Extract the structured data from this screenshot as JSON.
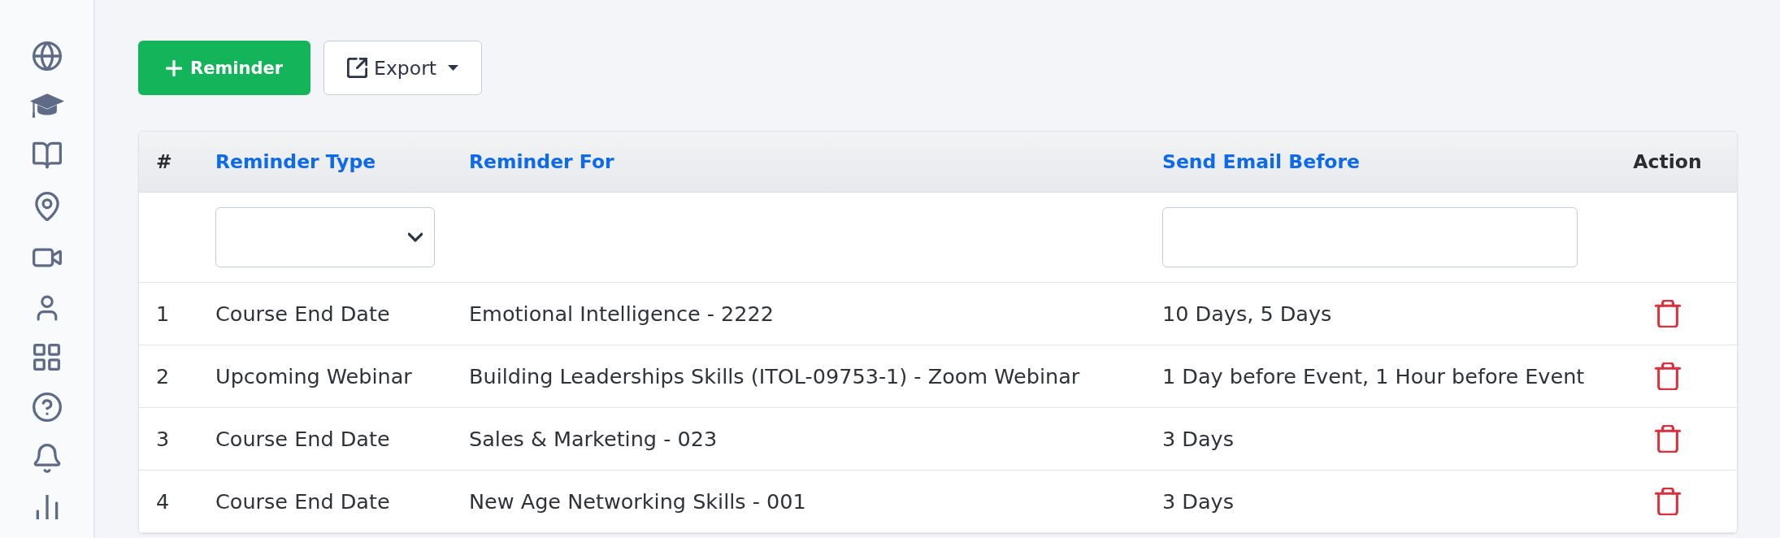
{
  "toolbar": {
    "buttons": [
      {
        "kind": "add",
        "label": "Reminder"
      },
      {
        "kind": "dropdown",
        "label": "Export"
      }
    ]
  },
  "table": {
    "columns": [
      {
        "label": "#",
        "sortable": false
      },
      {
        "label": "Reminder Type",
        "sortable": true
      },
      {
        "label": "Reminder For",
        "sortable": true
      },
      {
        "label": "Send Email Before",
        "sortable": true
      },
      {
        "label": "Action",
        "sortable": false
      }
    ],
    "filters": [
      {
        "kind": "none"
      },
      {
        "kind": "select"
      },
      {
        "kind": "none"
      },
      {
        "kind": "text"
      },
      {
        "kind": "none"
      }
    ],
    "rows": [
      {
        "number": "1",
        "reminder_type": "Course End Date",
        "reminder_for": "Emotional Intelligence - 2222",
        "send_email_before": "10 Days, 5 Days"
      },
      {
        "number": "2",
        "reminder_type": "Upcoming Webinar",
        "reminder_for": "Building Leaderships Skills (ITOL-09753-1) - Zoom Webinar",
        "send_email_before": "1 Day before Event, 1 Hour before Event"
      },
      {
        "number": "3",
        "reminder_type": "Course End Date",
        "reminder_for": "Sales & Marketing - 023",
        "send_email_before": "3 Days"
      },
      {
        "number": "4",
        "reminder_type": "Course End Date",
        "reminder_for": "New Age Networking Skills - 001",
        "send_email_before": "3 Days"
      }
    ]
  }
}
